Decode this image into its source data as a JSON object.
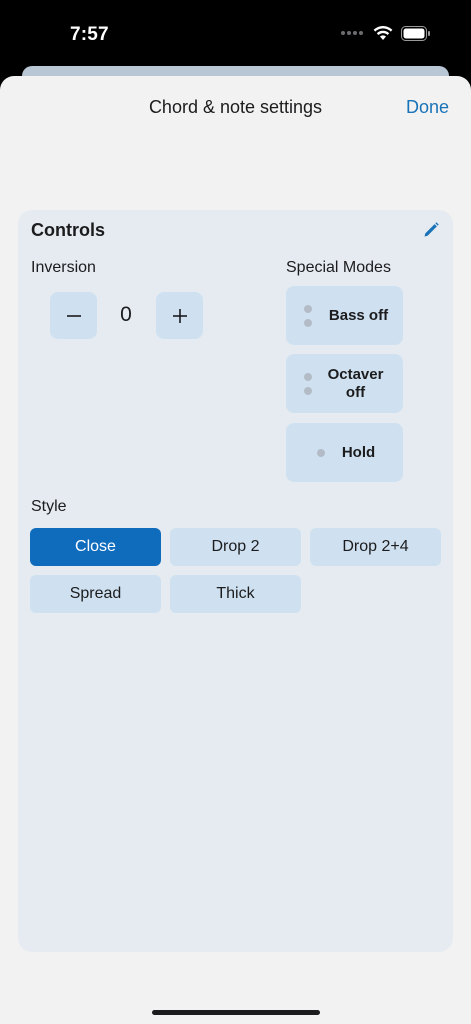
{
  "status_bar": {
    "time": "7:57"
  },
  "sheet": {
    "title": "Chord & note settings",
    "done_label": "Done"
  },
  "controls": {
    "title": "Controls",
    "inversion": {
      "label": "Inversion",
      "value": "0",
      "decrement_symbol": "−",
      "increment_symbol": "+"
    },
    "special_modes": {
      "label": "Special Modes",
      "modes": [
        {
          "label": "Bass off"
        },
        {
          "label": "Octaver off"
        },
        {
          "label": "Hold"
        }
      ]
    },
    "style": {
      "label": "Style",
      "options": [
        "Close",
        "Drop 2",
        "Drop 2+4",
        "Spread",
        "Thick"
      ],
      "selected": "Close"
    }
  },
  "colors": {
    "accent": "#0f6cbd",
    "button_bg": "#cfe1f0",
    "card_bg": "#e5ebf1"
  }
}
